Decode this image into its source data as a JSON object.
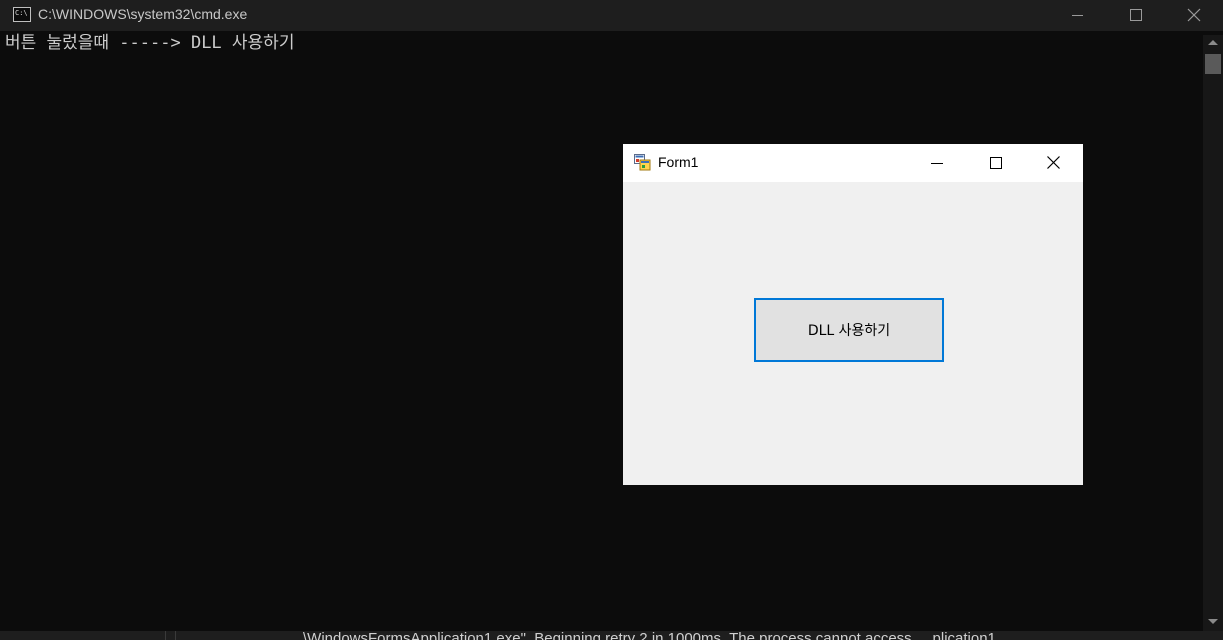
{
  "console_window": {
    "title": "C:\\WINDOWS\\system32\\cmd.exe",
    "icon_text": "C:\\",
    "output_lines": [
      "버튼 눌렀을때 -----> DLL 사용하기"
    ]
  },
  "background_window": {
    "partial_text": "\\WindowsFormsApplication1.exe\". Beginning retry 2 in 1000ms. The process cannot access     plication1"
  },
  "form_window": {
    "title": "Form1",
    "button_label": "DLL 사용하기"
  },
  "icons": {
    "console": "console-app-icon",
    "form": "winforms-app-icon",
    "minimize": "minimize-icon",
    "maximize": "maximize-icon",
    "close": "close-icon"
  },
  "colors": {
    "console_background": "#0c0c0c",
    "console_text": "#cccccc",
    "form_background": "#f0f0f0",
    "button_focus_border": "#0078d7"
  }
}
